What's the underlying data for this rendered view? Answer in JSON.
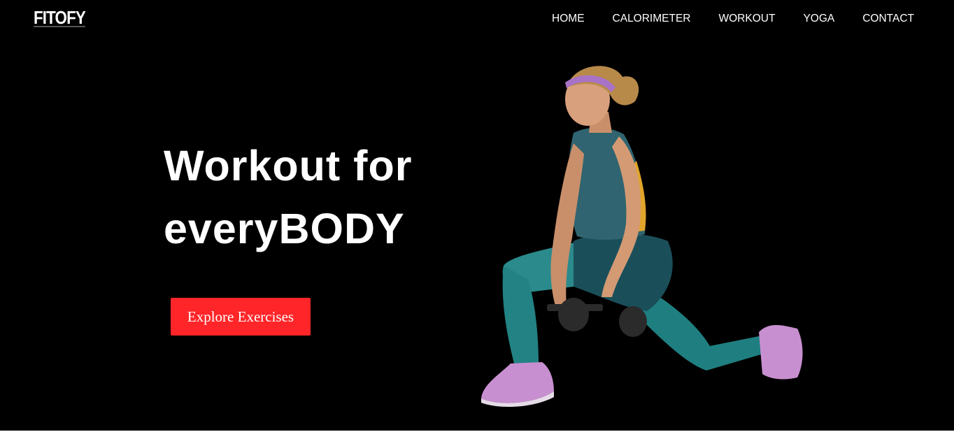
{
  "brand": {
    "logo_text": "FITOFY"
  },
  "nav": {
    "items": [
      {
        "label": "HOME"
      },
      {
        "label": "CALORIMETER"
      },
      {
        "label": "WORKOUT"
      },
      {
        "label": "YOGA"
      },
      {
        "label": "CONTACT"
      }
    ]
  },
  "hero": {
    "headline_line1": "Workout for",
    "headline_line2": "everyBODY",
    "cta_label": "Explore Exercises",
    "image_subject": "woman-lunge-dumbbells"
  },
  "colors": {
    "background": "#000000",
    "text": "#ffffff",
    "cta": "#ff2528"
  }
}
